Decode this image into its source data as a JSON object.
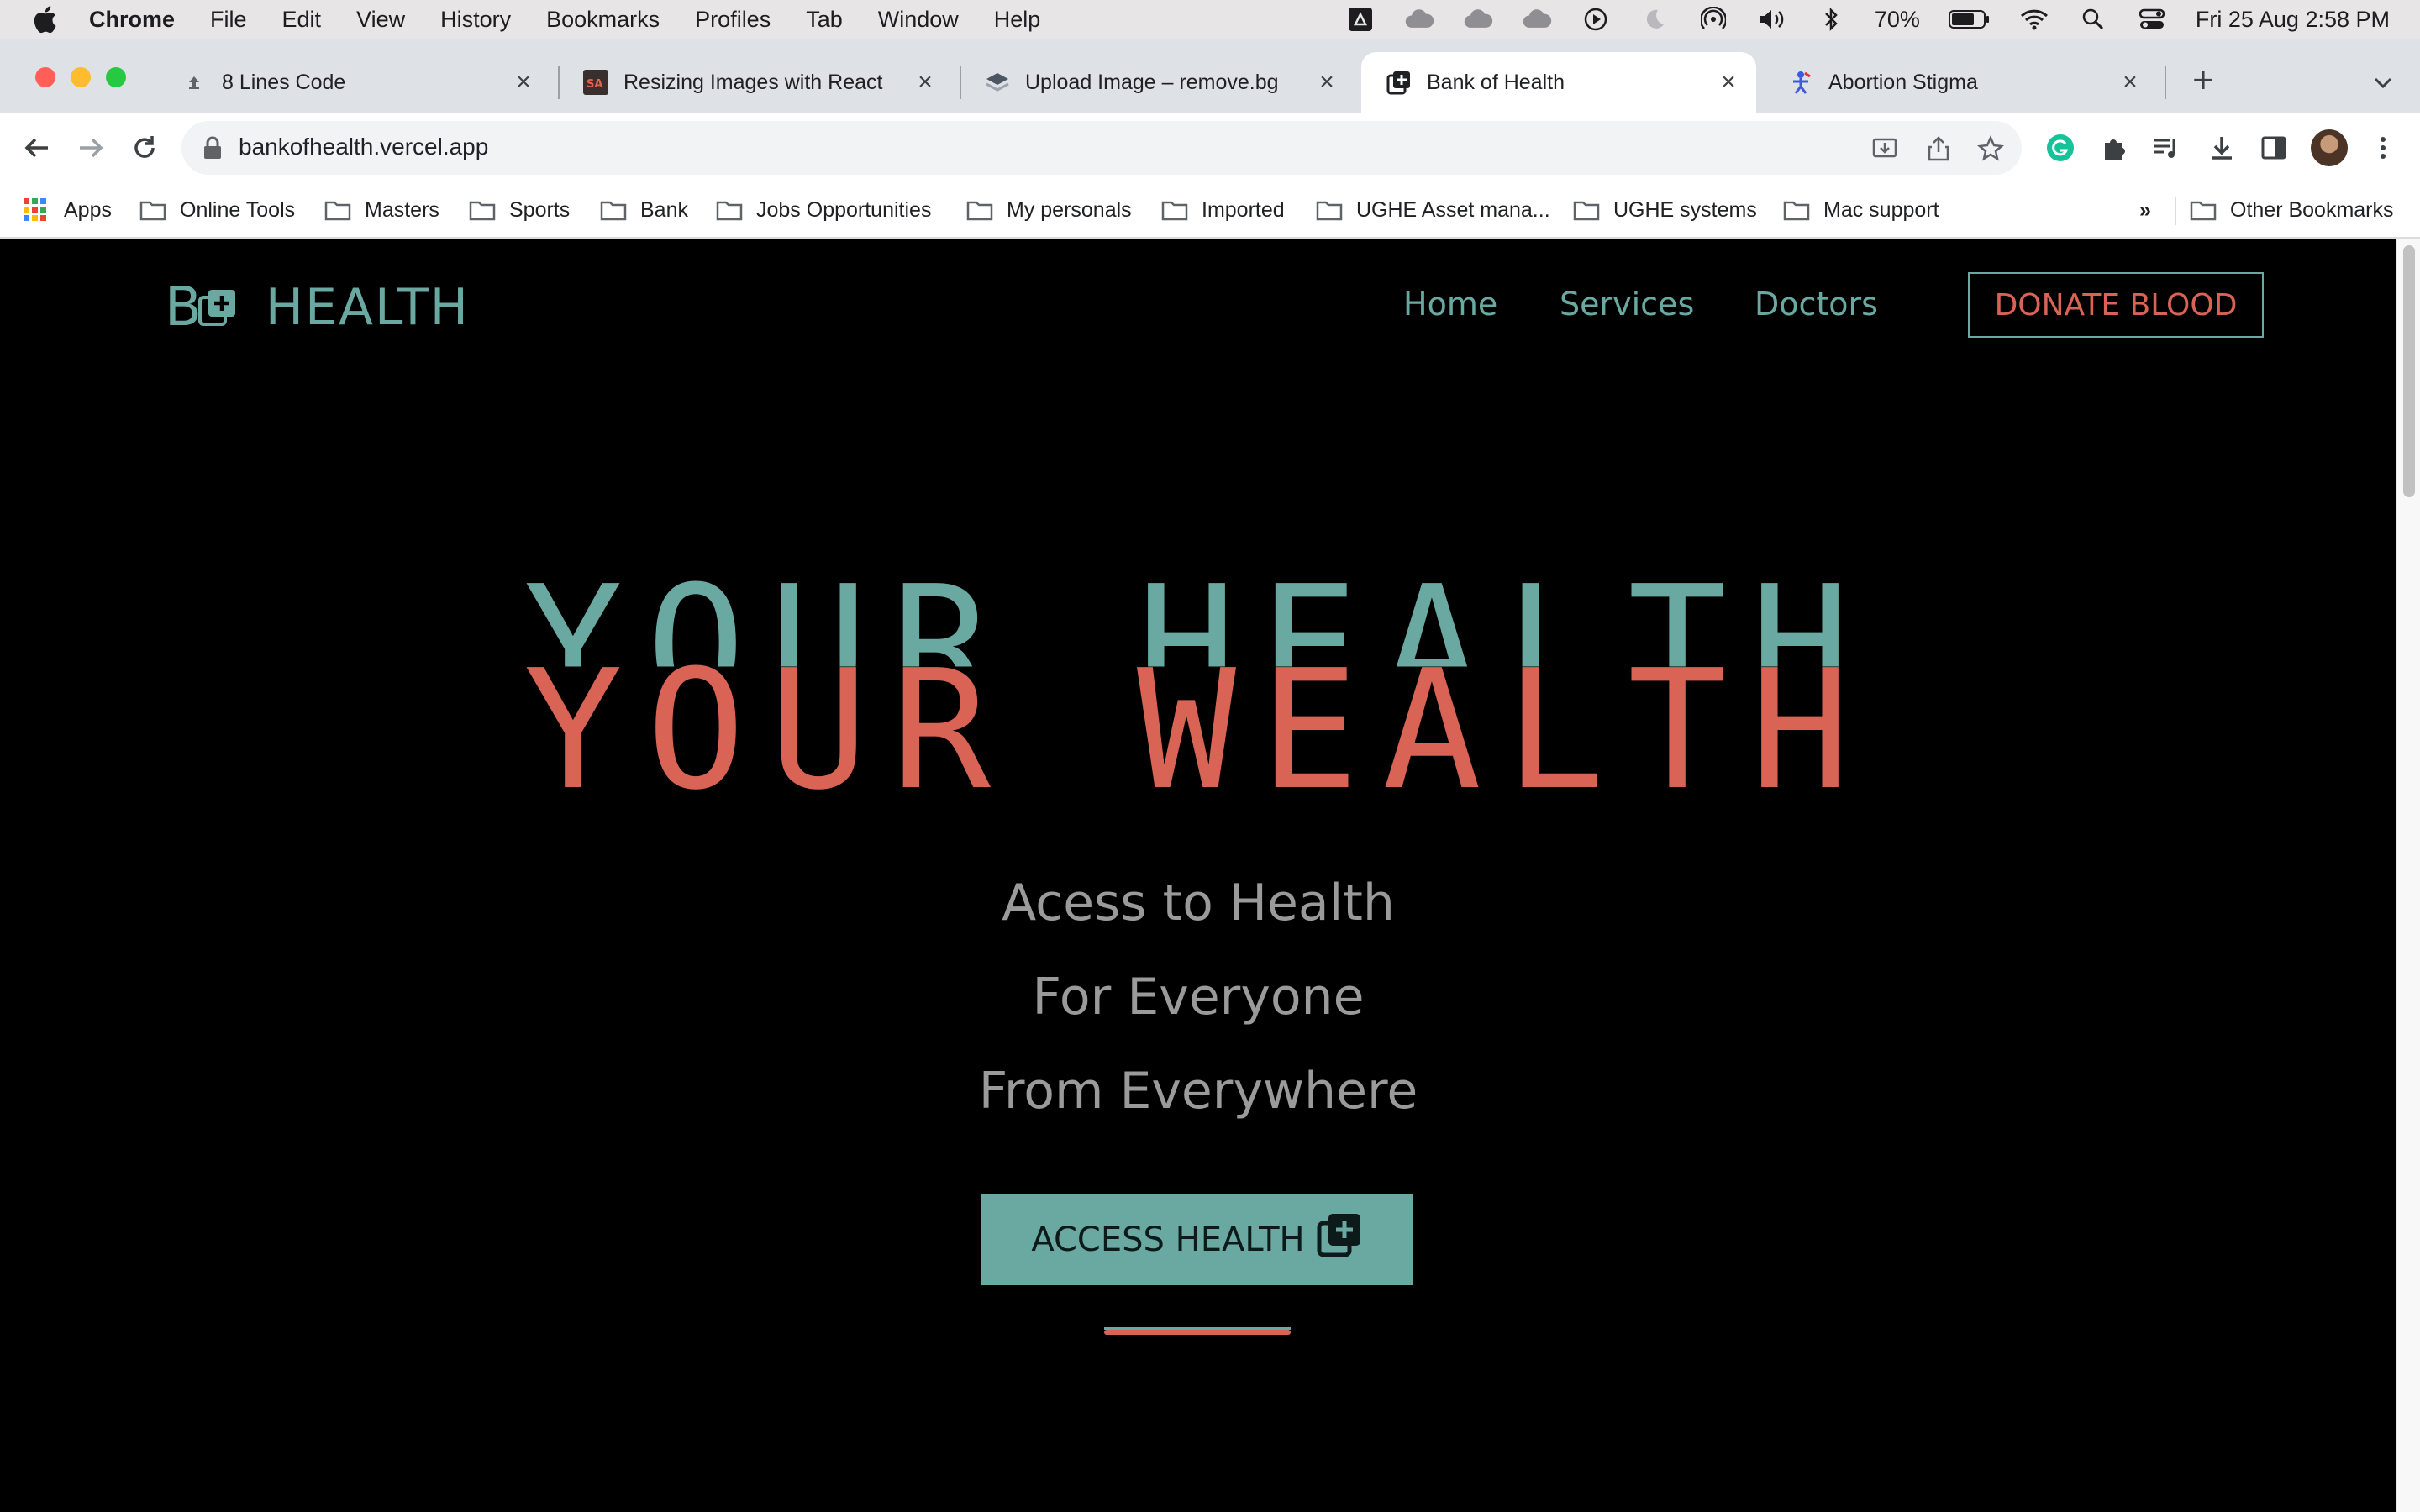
{
  "menubar": {
    "app_name": "Chrome",
    "items": [
      "File",
      "Edit",
      "View",
      "History",
      "Bookmarks",
      "Profiles",
      "Tab",
      "Window",
      "Help"
    ],
    "battery": "70%",
    "datetime": "Fri 25 Aug  2:58 PM"
  },
  "tabs": [
    {
      "title": "8 Lines Code",
      "icon": "upload-icon",
      "active": false
    },
    {
      "title": "Resizing Images with React",
      "icon": "sa-favicon",
      "active": false
    },
    {
      "title": "Upload Image – remove.bg",
      "icon": "removebg-favicon",
      "active": false
    },
    {
      "title": "Bank of Health",
      "icon": "bank-of-health-favicon",
      "active": true
    },
    {
      "title": "Abortion Stigma",
      "icon": "figure-favicon",
      "active": false
    }
  ],
  "address_bar": {
    "url": "bankofhealth.vercel.app"
  },
  "bookmarks": {
    "apps_label": "Apps",
    "folders": [
      "Online Tools",
      "Masters",
      "Sports",
      "Bank",
      "Jobs Opportunities",
      "My personals",
      "Imported",
      "UGHE Asset mana...",
      "UGHE systems",
      "Mac support"
    ],
    "overflow": "»",
    "other": "Other Bookmarks"
  },
  "site": {
    "logo_letter": "B",
    "logo_word": "HEALTH",
    "nav": [
      "Home",
      "Services",
      "Doctors"
    ],
    "donate_label": "DONATE BLOOD",
    "hero_line1": "YOUR HEALTH",
    "hero_line2": "YOUR WEALTH",
    "sub_lines": [
      "Acess to Health",
      "For Everyone",
      "From Everywhere"
    ],
    "cta_label": "ACCESS HEALTH"
  },
  "colors": {
    "teal": "#6aa9a2",
    "red": "#d96355",
    "background": "#000000"
  }
}
